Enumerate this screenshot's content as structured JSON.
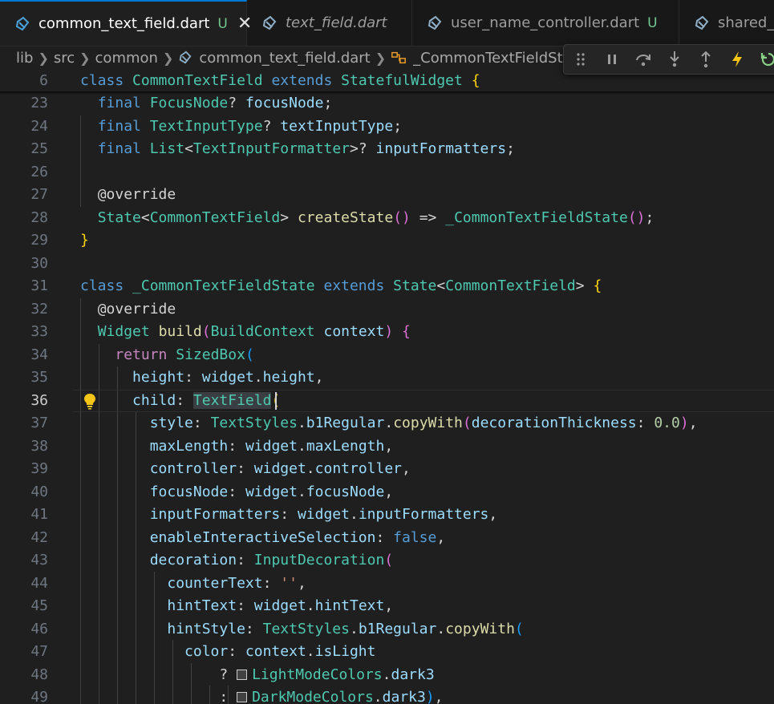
{
  "tabs": [
    {
      "label": "common_text_field.dart",
      "status": "U",
      "active": true,
      "close": "✕"
    },
    {
      "label": "text_field.dart",
      "italic": true
    },
    {
      "label": "user_name_controller.dart",
      "status": "U"
    },
    {
      "label": "shared_p"
    }
  ],
  "breadcrumb": [
    "lib",
    "src",
    "common",
    "common_text_field.dart",
    "_CommonTextFieldState"
  ],
  "debug_toolbar": [
    "drag-handle-icon",
    "pause-icon",
    "step-over-icon",
    "step-into-icon",
    "step-out-icon",
    "hot-reload-icon",
    "restart-icon"
  ],
  "colors": {
    "dart_icon": "#4ba3d9",
    "keyword": "#569cd6",
    "type": "#4ec9b0",
    "function": "#dcdcaa",
    "variable": "#9cdcfe",
    "string": "#ce9178",
    "bracket_level1": "#ffd700",
    "bracket_level2": "#da70d6",
    "bracket_level3": "#179fff",
    "bulb": "#f5c518"
  },
  "sticky_line": {
    "number": "6",
    "text": "class CommonTextField extends StatefulWidget {"
  },
  "current_line": "36",
  "lines": [
    {
      "n": "23",
      "text": "  final FocusNode? focusNode;"
    },
    {
      "n": "24",
      "text": "  final TextInputType? textInputType;"
    },
    {
      "n": "25",
      "text": "  final List<TextInputFormatter>? inputFormatters;"
    },
    {
      "n": "26",
      "text": ""
    },
    {
      "n": "27",
      "text": "  @override"
    },
    {
      "n": "28",
      "text": "  State<CommonTextField> createState() => _CommonTextFieldState();"
    },
    {
      "n": "29",
      "text": "}"
    },
    {
      "n": "30",
      "text": ""
    },
    {
      "n": "31",
      "text": "class _CommonTextFieldState extends State<CommonTextField> {"
    },
    {
      "n": "32",
      "text": "  @override"
    },
    {
      "n": "33",
      "text": "  Widget build(BuildContext context) {"
    },
    {
      "n": "34",
      "text": "    return SizedBox("
    },
    {
      "n": "35",
      "text": "      height: widget.height,"
    },
    {
      "n": "36",
      "text": "      child: TextField("
    },
    {
      "n": "37",
      "text": "        style: TextStyles.b1Regular.copyWith(decorationThickness: 0.0),"
    },
    {
      "n": "38",
      "text": "        maxLength: widget.maxLength,"
    },
    {
      "n": "39",
      "text": "        controller: widget.controller,"
    },
    {
      "n": "40",
      "text": "        focusNode: widget.focusNode,"
    },
    {
      "n": "41",
      "text": "        inputFormatters: widget.inputFormatters,"
    },
    {
      "n": "42",
      "text": "        enableInteractiveSelection: false,"
    },
    {
      "n": "43",
      "text": "        decoration: InputDecoration("
    },
    {
      "n": "44",
      "text": "          counterText: '',"
    },
    {
      "n": "45",
      "text": "          hintText: widget.hintText,"
    },
    {
      "n": "46",
      "text": "          hintStyle: TextStyles.b1Regular.copyWith("
    },
    {
      "n": "47",
      "text": "            color: context.isLight"
    },
    {
      "n": "48",
      "text": "                ? LightModeColors.dark3"
    },
    {
      "n": "49",
      "text": "                : DarkModeColors.dark3),"
    }
  ]
}
